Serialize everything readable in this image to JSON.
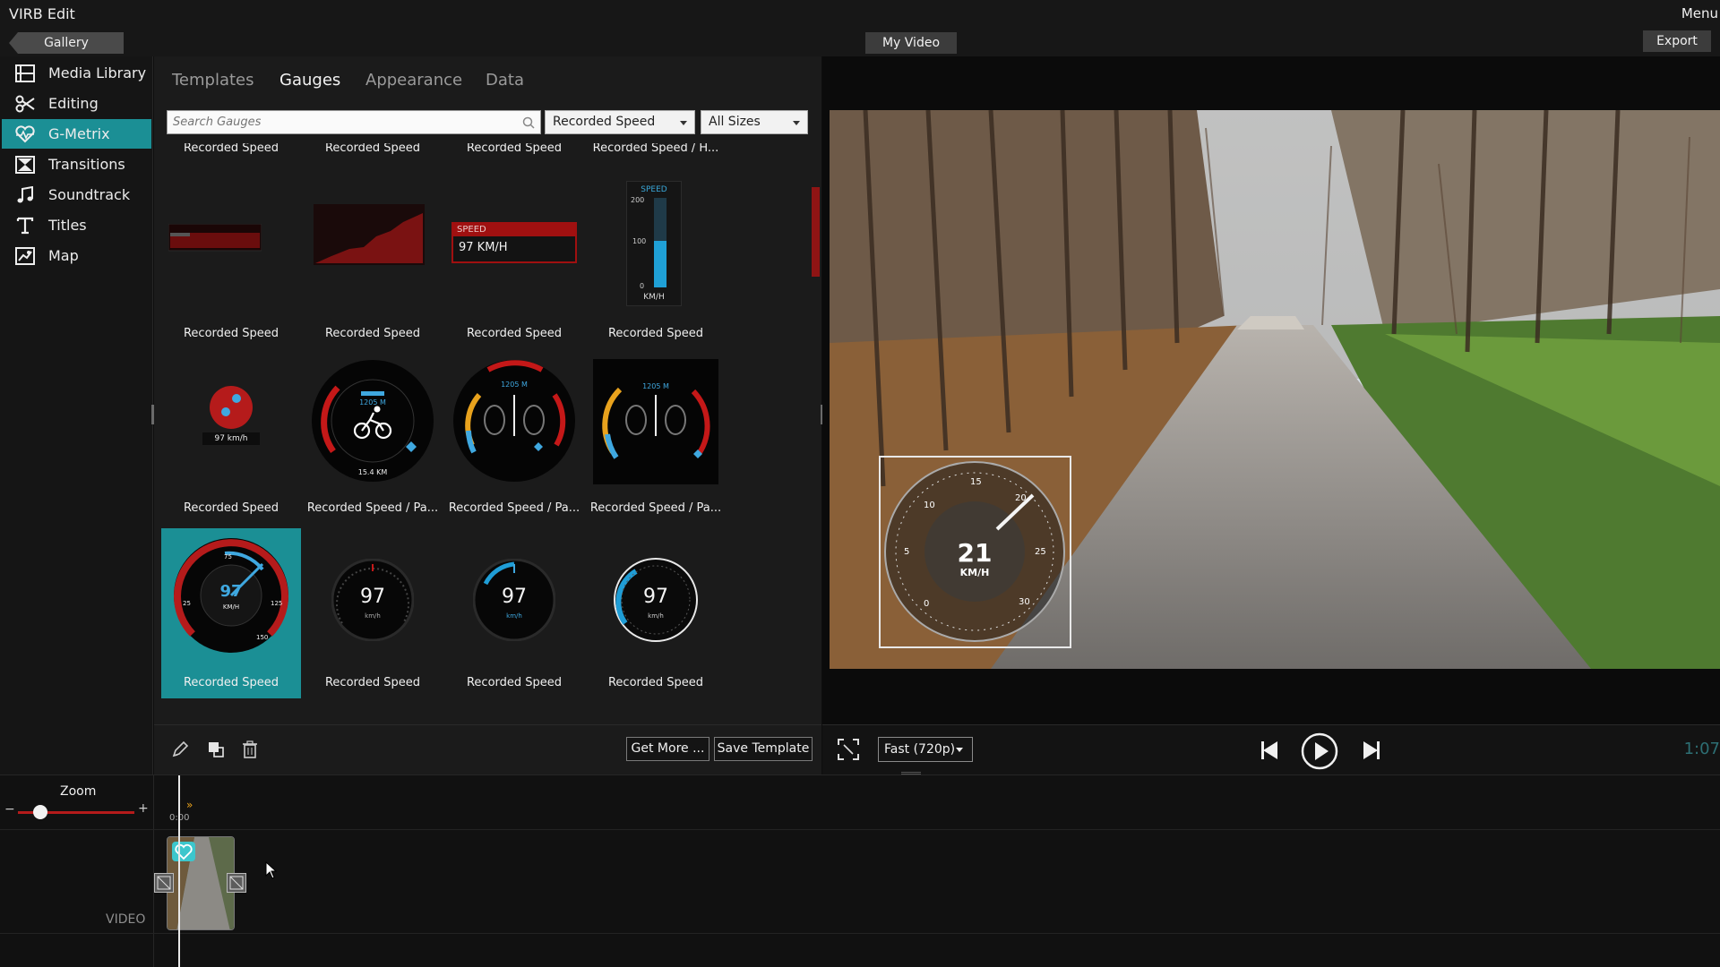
{
  "app": {
    "title": "VIRB Edit",
    "menu_label": "Menu",
    "gallery_label": "Gallery",
    "project_name": "My Video",
    "export_label": "Export"
  },
  "sidebar": {
    "items": [
      {
        "label": "Media Library",
        "icon": "film-icon"
      },
      {
        "label": "Editing",
        "icon": "scissors-icon"
      },
      {
        "label": "G-Metrix",
        "icon": "heartbeat-icon",
        "active": true
      },
      {
        "label": "Transitions",
        "icon": "hourglass-icon"
      },
      {
        "label": "Soundtrack",
        "icon": "music-note-icon"
      },
      {
        "label": "Titles",
        "icon": "text-t-icon"
      },
      {
        "label": "Map",
        "icon": "map-icon"
      }
    ]
  },
  "panel": {
    "tabs": [
      "Templates",
      "Gauges",
      "Appearance",
      "Data"
    ],
    "active_tab": "Gauges",
    "search_placeholder": "Search Gauges",
    "data_filter": "Recorded Speed",
    "size_filter": "All Sizes",
    "header_row": [
      "Recorded Speed",
      "Recorded Speed",
      "Recorded Speed",
      "Recorded Speed / H..."
    ],
    "rows": [
      [
        "Recorded Speed",
        "Recorded Speed",
        "Recorded Speed",
        "Recorded Speed"
      ],
      [
        "Recorded Speed",
        "Recorded Speed / Pa...",
        "Recorded Speed / Pa...",
        "Recorded Speed / Pa..."
      ],
      [
        "Recorded Speed",
        "Recorded Speed",
        "Recorded Speed",
        "Recorded Speed"
      ]
    ],
    "thumbs": {
      "speed_text": "SPEED",
      "speed_value": "97 KM/H",
      "vert_title": "SPEED",
      "vert_ticks": [
        "200",
        "100",
        "0"
      ],
      "vert_unit": "KM/H",
      "small_value": "97 km/h",
      "gauge_value": "97",
      "gauge_unit_upper": "KM/H",
      "gauge_unit_lower": "km/h",
      "altitude": "1205 M",
      "distance": "15.4 KM",
      "red_ticks": [
        "25",
        "75",
        "125",
        "150"
      ]
    },
    "get_more_label": "Get More ...",
    "save_template_label": "Save Template"
  },
  "preview": {
    "overlay_speed": "21",
    "overlay_unit": "KM/H",
    "overlay_ticks": [
      "5",
      "10",
      "15",
      "20",
      "25",
      "30",
      "0"
    ],
    "quality": "Fast (720p)",
    "time": "1:07"
  },
  "timeline": {
    "zoom_label": "Zoom",
    "zoom_minus": "−",
    "zoom_plus": "+",
    "ruler_start": "0:00",
    "track_label": "VIDEO"
  },
  "colors": {
    "accent": "#1b8f95",
    "red": "#b51b1b",
    "panel": "#1b1b1b"
  }
}
